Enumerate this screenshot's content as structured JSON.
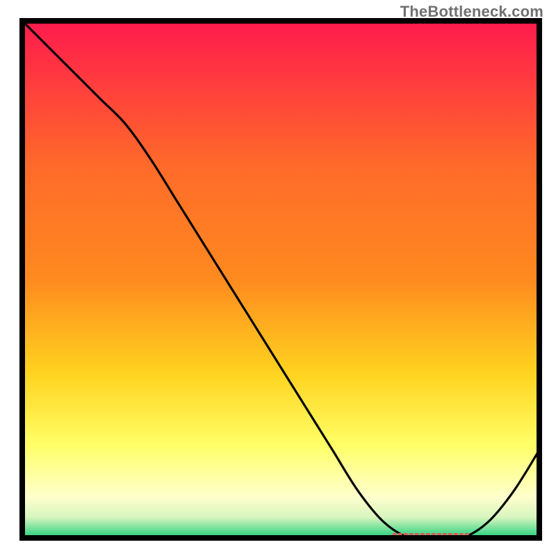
{
  "watermark": "TheBottleneck.com",
  "colors": {
    "frame": "#000000",
    "curve": "#000000",
    "marker": "#e05a5a",
    "gradient_top": "#ff1a4d",
    "gradient_mid1": "#ff8a1f",
    "gradient_mid2": "#ffd21f",
    "gradient_mid3": "#ffff66",
    "gradient_pale": "#ffffcc",
    "gradient_green": "#21d07a"
  },
  "chart_data": {
    "type": "line",
    "title": "",
    "xlabel": "",
    "ylabel": "",
    "xlim": [
      0,
      100
    ],
    "ylim": [
      0,
      100
    ],
    "series": [
      {
        "name": "bottleneck-curve",
        "x": [
          0,
          5,
          10,
          15,
          20,
          25,
          30,
          35,
          40,
          45,
          50,
          55,
          60,
          65,
          70,
          75,
          80,
          85,
          90,
          95,
          100
        ],
        "y": [
          100,
          95,
          90,
          85,
          80,
          73,
          65,
          57,
          49,
          41,
          33,
          25,
          17,
          9,
          3,
          0,
          0,
          0,
          3,
          9,
          17
        ]
      }
    ],
    "annotations": [
      {
        "name": "optimal-marker",
        "x_start": 72,
        "x_end": 86,
        "y": 0
      }
    ]
  }
}
